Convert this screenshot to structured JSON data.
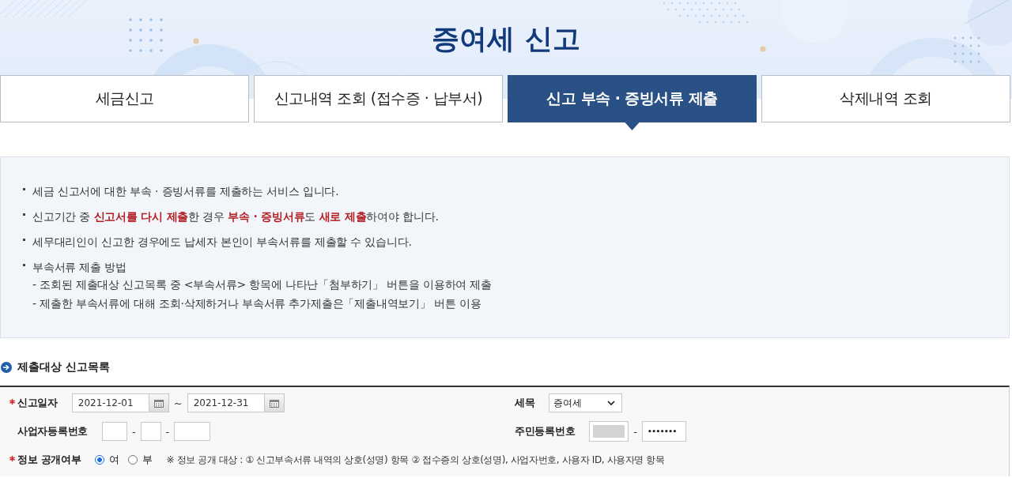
{
  "header": {
    "title": "증여세 신고"
  },
  "tabs": [
    {
      "label": "세금신고",
      "selected": false
    },
    {
      "label": "신고내역 조회 (접수증 · 납부서)",
      "selected": false
    },
    {
      "label": "신고 부속 · 증빙서류 제출",
      "selected": true
    },
    {
      "label": "삭제내역 조회",
      "selected": false
    }
  ],
  "notice": {
    "items": [
      {
        "text": "세금 신고서에 대한 부속 · 증빙서류를 제출하는 서비스 입니다."
      },
      {
        "text": "신고기간 중 **신고서를 다시 제출**한 경우 **부속 · 증빙서류**도 **새로 제출**하여야 합니다."
      },
      {
        "text": "세무대리인이 신고한 경우에도 납세자 본인이 부속서류를 제출할 수 있습니다."
      },
      {
        "text": "부속서류 제출 방법",
        "children": [
          {
            "text": "- 조회된 제출대상 신고목록 중 <부속서류> 항목에 나타난「첨부하기」 버튼을 이용하여 제출"
          },
          {
            "text": "- 제출한 부속서류에 대해 조회·삭제하거나 부속서류 추가제출은「제출내역보기」 버튼 이용"
          }
        ]
      }
    ]
  },
  "section": {
    "title": "제출대상 신고목록"
  },
  "form": {
    "rows": [
      {
        "items": [
          {
            "label": "신고일자",
            "required": true,
            "fields": [
              {
                "kind": "date",
                "value": "2021-12-01"
              },
              {
                "kind": "separator",
                "text": "~"
              },
              {
                "kind": "date",
                "value": "2021-12-31"
              }
            ]
          },
          {
            "label": "세목",
            "required": false,
            "fields": [
              {
                "kind": "select",
                "value": "증여세"
              }
            ]
          }
        ]
      },
      {
        "items": [
          {
            "label": "사업자등록번호",
            "required": false,
            "fields": [
              {
                "kind": "text",
                "redacted": false
              },
              {
                "kind": "separator",
                "text": "-"
              },
              {
                "kind": "text",
                "redacted": false
              },
              {
                "kind": "separator",
                "text": "-"
              },
              {
                "kind": "text",
                "redacted": false
              }
            ]
          },
          {
            "label": "주민등록번호",
            "required": false,
            "fields": [
              {
                "kind": "text",
                "redacted": true
              },
              {
                "kind": "separator",
                "text": "-"
              },
              {
                "kind": "text",
                "redacted": false,
                "value": "•••••••"
              }
            ]
          }
        ]
      },
      {
        "items": [
          {
            "label": "정보 공개여부",
            "required": true,
            "fields": [
              {
                "kind": "radio",
                "label": "여",
                "selected": true
              },
              {
                "kind": "radio",
                "label": "부",
                "selected": false
              },
              {
                "kind": "note",
                "text": "※ 정보 공개 대상 : ① 신고부속서류 내역의 상호(성명) 항목 ② 접수증의 상호(성명), 사업자번호, 사용자 ID, 사용자명 항목"
              }
            ]
          }
        ]
      }
    ]
  }
}
